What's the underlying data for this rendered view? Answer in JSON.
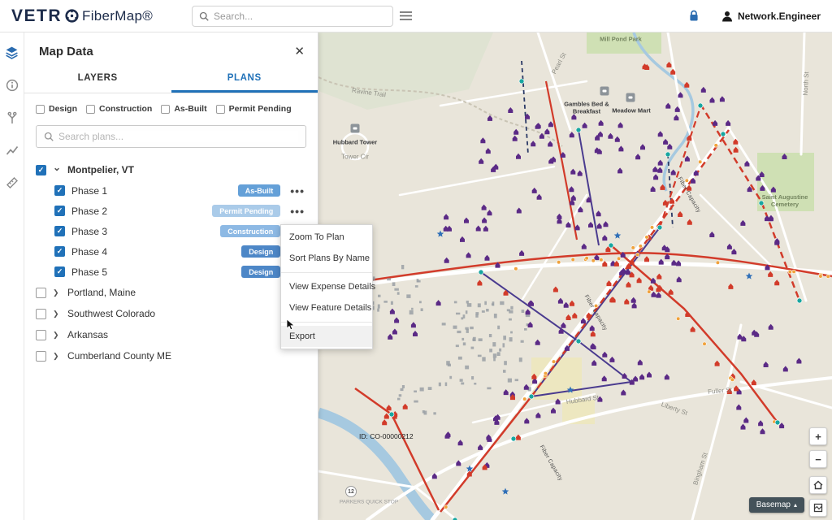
{
  "header": {
    "logo_brand": "VETR",
    "logo_product": "FiberMap®",
    "search_placeholder": "Search...",
    "user_name": "Network.Engineer"
  },
  "panel": {
    "title": "Map Data",
    "close_label": "✕",
    "tabs": {
      "layers": "LAYERS",
      "plans": "PLANS"
    },
    "filters": {
      "design": "Design",
      "construction": "Construction",
      "as_built": "As-Built",
      "permit_pending": "Permit Pending"
    },
    "search_placeholder": "Search plans...",
    "tree": {
      "menu_label": "•••",
      "parents": [
        {
          "label": "Montpelier, VT",
          "checked": true,
          "expanded": true
        },
        {
          "label": "Portland, Maine",
          "checked": false,
          "expanded": false
        },
        {
          "label": "Southwest Colorado",
          "checked": false,
          "expanded": false
        },
        {
          "label": "Arkansas",
          "checked": false,
          "expanded": false
        },
        {
          "label": "Cumberland County ME",
          "checked": false,
          "expanded": false
        }
      ],
      "children": [
        {
          "label": "Phase 1",
          "checked": true,
          "badge": "As-Built",
          "badge_color": "#64a0d8"
        },
        {
          "label": "Phase 2",
          "checked": true,
          "badge": "Permit Pending",
          "badge_color": "#aacbe9"
        },
        {
          "label": "Phase 3",
          "checked": true,
          "badge": "Construction",
          "badge_color": "#8db9e4"
        },
        {
          "label": "Phase 4",
          "checked": true,
          "badge": "Design",
          "badge_color": "#4d87c7"
        },
        {
          "label": "Phase 5",
          "checked": true,
          "badge": "Design",
          "badge_color": "#4d87c7"
        }
      ]
    }
  },
  "context_menu": {
    "items": [
      "Zoom To Plan",
      "Sort Plans By Name",
      "View Expense Details",
      "View Feature Details",
      "Export"
    ]
  },
  "map": {
    "feature_id": "ID: CO-00000212",
    "route_shield": "12",
    "controls": {
      "zoom_in": "+",
      "zoom_out": "−",
      "basemap": "Basemap"
    },
    "labels": [
      {
        "text": "Mill Pond Park"
      },
      {
        "text": "Pearl St"
      },
      {
        "text": "North St"
      },
      {
        "text": "Gambles Bed & Breakfast"
      },
      {
        "text": "Meadow Mart"
      },
      {
        "text": "Ravine Trail"
      },
      {
        "text": "Hubbard Tower"
      },
      {
        "text": "Tower Cir"
      },
      {
        "text": "Saint Augustine Cemetery"
      },
      {
        "text": "Fiber Capacity"
      },
      {
        "text": "Fiber Capacity"
      },
      {
        "text": "Fiber Capacity"
      },
      {
        "text": "Hubbard St"
      },
      {
        "text": "Fuller St"
      },
      {
        "text": "Liberty St"
      },
      {
        "text": "Bingham St"
      },
      {
        "text": "PARKERS QUICK STOP"
      }
    ],
    "colors": {
      "purple_marker": "#5b2a86",
      "red_marker": "#d23b2a",
      "orange_node": "#f0a23c",
      "teal_node": "#18a6a0",
      "star": "#2f6fb7",
      "fiber_red": "#d23b2a",
      "fiber_purple": "#4a3b8f",
      "river": "#a6c9e0"
    }
  }
}
